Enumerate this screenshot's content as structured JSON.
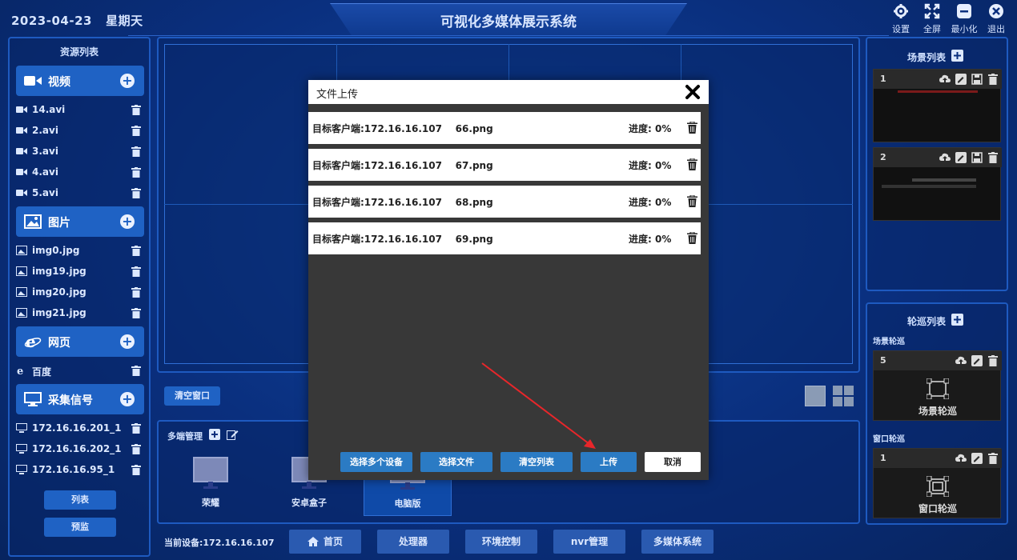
{
  "header": {
    "date": "2023-04-23",
    "weekday": "星期天",
    "title": "可视化多媒体展示系统",
    "buttons": [
      {
        "label": "设置",
        "icon": "gear-icon"
      },
      {
        "label": "全屏",
        "icon": "fullscreen-icon"
      },
      {
        "label": "最小化",
        "icon": "minimize-icon"
      },
      {
        "label": "退出",
        "icon": "exit-icon"
      }
    ]
  },
  "resources": {
    "title": "资源列表",
    "categories": {
      "video": {
        "label": "视频",
        "items": [
          "14.avi",
          "2.avi",
          "3.avi",
          "4.avi",
          "5.avi"
        ]
      },
      "image": {
        "label": "图片",
        "items": [
          "img0.jpg",
          "img19.jpg",
          "img20.jpg",
          "img21.jpg"
        ]
      },
      "web": {
        "label": "网页",
        "items": [
          "百度"
        ]
      },
      "capture": {
        "label": "采集信号",
        "items": [
          "172.16.16.201_1",
          "172.16.16.202_1",
          "172.16.16.95_1"
        ]
      }
    },
    "list_btn": "列表",
    "preview_btn": "预监"
  },
  "stage": {
    "clear_btn": "清空窗口"
  },
  "multi": {
    "title": "多端管理",
    "devices": [
      "荣耀",
      "安卓盒子",
      "电脑版"
    ],
    "current_device": "当前设备:172.16.16.107"
  },
  "nav": [
    "首页",
    "处理器",
    "环境控制",
    "nvr管理",
    "多媒体系统"
  ],
  "scenes": {
    "title": "场景列表",
    "cards": [
      {
        "num": "1"
      },
      {
        "num": "2"
      }
    ]
  },
  "tours": {
    "title": "轮巡列表",
    "scene_tour_label": "场景轮巡",
    "scene_card_num": "5",
    "scene_card_label": "场景轮巡",
    "window_tour_label": "窗口轮巡",
    "window_card_num": "1",
    "window_card_label": "窗口轮巡"
  },
  "modal": {
    "title": "文件上传",
    "rows": [
      {
        "target": "目标客户端:172.16.16.107    66.png",
        "progress": "进度: 0%"
      },
      {
        "target": "目标客户端:172.16.16.107    67.png",
        "progress": "进度: 0%"
      },
      {
        "target": "目标客户端:172.16.16.107    68.png",
        "progress": "进度: 0%"
      },
      {
        "target": "目标客户端:172.16.16.107    69.png",
        "progress": "进度: 0%"
      }
    ],
    "buttons": {
      "select_devices": "选择多个设备",
      "select_file": "选择文件",
      "clear_list": "清空列表",
      "upload": "上传",
      "cancel": "取消"
    }
  },
  "colors": {
    "background": "#0a2f7e",
    "accent": "#1f62c4",
    "upload_btn": "#2b7bc4",
    "arrow": "#e8262a"
  }
}
